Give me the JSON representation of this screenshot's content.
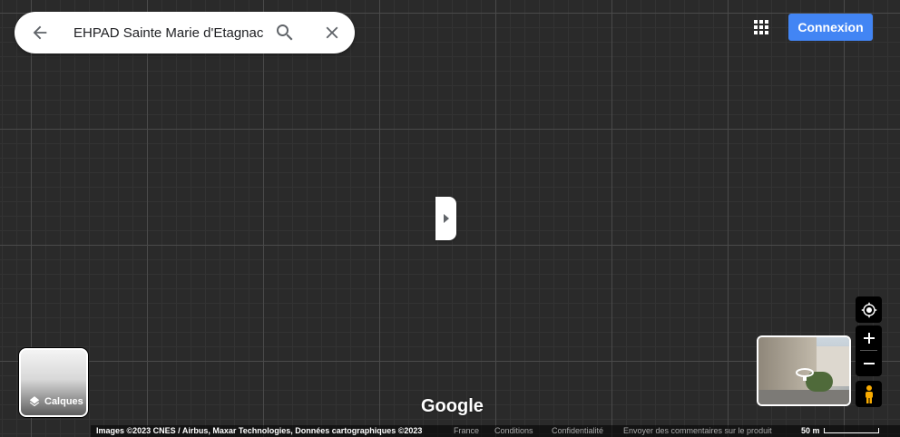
{
  "search": {
    "value": "EHPAD Sainte Marie d'Etagnac"
  },
  "header": {
    "signin_label": "Connexion"
  },
  "layers": {
    "label": "Calques"
  },
  "logo": {
    "text": "Google"
  },
  "footer": {
    "credits": "Images ©2023 CNES / Airbus, Maxar Technologies, Données cartographiques ©2023",
    "links": [
      "France",
      "Conditions",
      "Confidentialité",
      "Envoyer des commentaires sur le produit"
    ],
    "scale_label": "50 m"
  },
  "colors": {
    "accent": "#4285f4",
    "map_bg": "#2a2a2a",
    "pegman": "#f9ab00"
  },
  "icons": {
    "back": "arrow-left-icon",
    "search": "search-icon",
    "clear": "close-icon",
    "apps": "apps-grid-icon",
    "collapse": "chevron-right-icon",
    "layers": "layers-icon",
    "locate": "my-location-icon",
    "zoom_in": "plus-icon",
    "zoom_out": "minus-icon",
    "pegman": "pegman-icon",
    "rotate": "rotate-360-icon"
  }
}
